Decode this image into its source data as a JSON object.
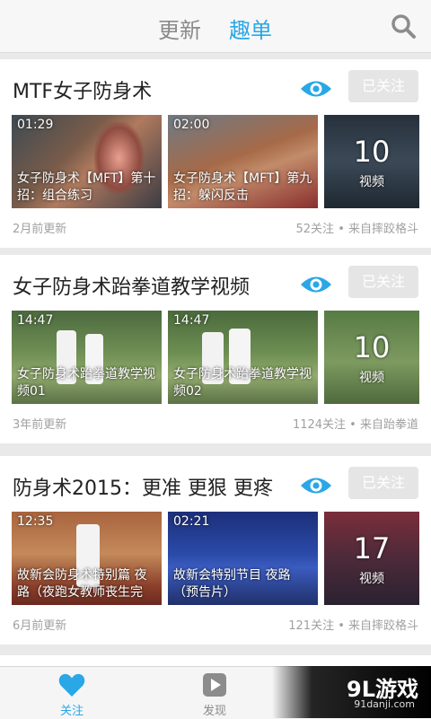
{
  "header": {
    "tab_update": "更新",
    "tab_qudan": "趣单",
    "active_color": "#2aa7e6"
  },
  "cards": [
    {
      "title": "MTF女子防身术",
      "follow": "已关注",
      "thumbs": [
        {
          "duration": "01:29",
          "caption": "女子防身术【MFT】第十招：组合练习"
        },
        {
          "duration": "02:00",
          "caption": "女子防身术【MFT】第九招：躲闪反击"
        },
        {
          "count": "10",
          "count_label": "视频"
        }
      ],
      "updated": "2月前更新",
      "stats": "52关注 • 来自摔跤格斗"
    },
    {
      "title": "女子防身术跆拳道教学视频",
      "follow": "已关注",
      "thumbs": [
        {
          "duration": "14:47",
          "caption": "女子防身术跆拳道教学视频01"
        },
        {
          "duration": "14:47",
          "caption": "女子防身术跆拳道教学视频02"
        },
        {
          "count": "10",
          "count_label": "视频"
        }
      ],
      "updated": "3年前更新",
      "stats": "1124关注 • 来自跆拳道"
    },
    {
      "title": "防身术2015：更准 更狠 更疼",
      "follow": "已关注",
      "thumbs": [
        {
          "duration": "12:35",
          "caption": "故新会防身术特别篇 夜路（夜跑女教师丧生完"
        },
        {
          "duration": "02:21",
          "caption": "故新会特别节目 夜路（预告片）"
        },
        {
          "count": "17",
          "count_label": "视频"
        }
      ],
      "updated": "6月前更新",
      "stats": "121关注 • 来自摔跤格斗"
    }
  ],
  "bottom_nav": {
    "follow": "关注",
    "discover": "发现"
  },
  "watermark": {
    "main": "9L游戏",
    "sub": "91danji.com"
  }
}
